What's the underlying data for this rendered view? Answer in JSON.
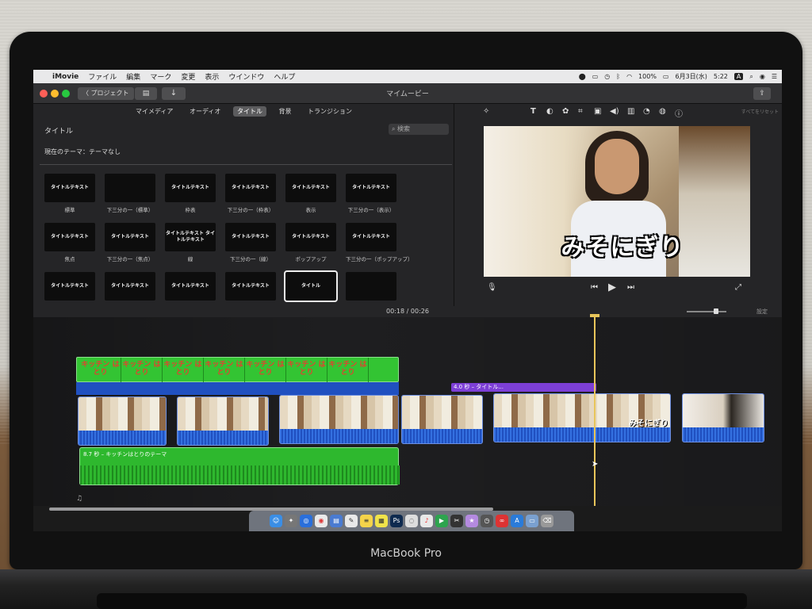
{
  "menubar": {
    "app": "iMovie",
    "items": [
      "ファイル",
      "編集",
      "マーク",
      "変更",
      "表示",
      "ウインドウ",
      "ヘルプ"
    ],
    "battery": "100%",
    "date": "6月3日(水)",
    "time": "5:22"
  },
  "toolbar": {
    "back_label": "〈 プロジェクト",
    "window_title": "マイムービー"
  },
  "browser": {
    "tabs": [
      {
        "label": "マイメディア",
        "active": false
      },
      {
        "label": "オーディオ",
        "active": false
      },
      {
        "label": "タイトル",
        "active": true
      },
      {
        "label": "背景",
        "active": false
      },
      {
        "label": "トランジション",
        "active": false
      }
    ],
    "header": "タイトル",
    "search_placeholder": "検索",
    "theme": "現在のテーマ：テーマなし",
    "titles": [
      {
        "thumb": "タイトルテキスト",
        "caption": "標準"
      },
      {
        "thumb": "",
        "caption": "下三分の一（標準）"
      },
      {
        "thumb": "タイトルテキスト",
        "caption": "枠表"
      },
      {
        "thumb": "タイトルテキスト",
        "caption": "下三分の一（枠表）"
      },
      {
        "thumb": "タイトルテキスト",
        "caption": "表示"
      },
      {
        "thumb": "タイトルテキスト",
        "caption": "下三分の一（表示）"
      },
      {
        "thumb": "タイトルテキスト",
        "caption": "焦点"
      },
      {
        "thumb": "タイトルテキスト",
        "caption": "下三分の一（焦点）"
      },
      {
        "thumb": "タイトルテキスト タイトルテキスト",
        "caption": "線"
      },
      {
        "thumb": "タイトルテキスト",
        "caption": "下三分の一（線）"
      },
      {
        "thumb": "タイトルテキスト",
        "caption": "ポップアップ"
      },
      {
        "thumb": "タイトルテキスト",
        "caption": "下三分の一（ポップアップ）"
      },
      {
        "thumb": "タイトルテキスト",
        "caption": ""
      },
      {
        "thumb": "タイトルテキスト",
        "caption": ""
      },
      {
        "thumb": "タイトルテキスト",
        "caption": ""
      },
      {
        "thumb": "タイトルテキスト",
        "caption": ""
      },
      {
        "thumb": "タイトル",
        "caption": ""
      },
      {
        "thumb": "",
        "caption": ""
      }
    ],
    "selected_index": 16
  },
  "viewer": {
    "reset_label": "すべてをリセット",
    "overlay_text": "みそにぎり"
  },
  "timebar": {
    "current": "00:18",
    "separator": "/",
    "total": "00:26",
    "setting_label": "設定"
  },
  "timeline": {
    "title_clip_cells": [
      "キッチン はとり",
      "キッチン はとり",
      "キッチン はとり",
      "キッチン はとり",
      "キッチン はとり",
      "キッチン はとり",
      "キッチン はとり"
    ],
    "title_label": "4.0 秒 – タイトル...",
    "clip_overlay": "みそにぎり",
    "audio_label": "8.7 秒 – キッチンはとりのテーマ"
  },
  "device": {
    "model_label": "MacBook Pro"
  },
  "colors": {
    "accent_title": "#7d3fd6",
    "audio_green": "#2eb82e",
    "video_blue": "#2050c0",
    "playhead": "#e8c55a"
  }
}
